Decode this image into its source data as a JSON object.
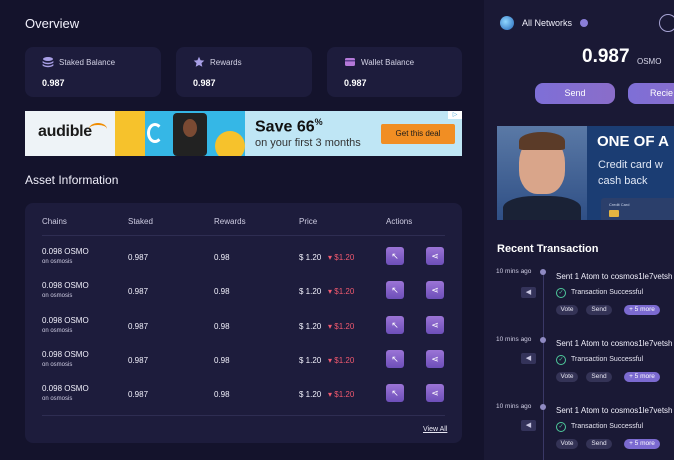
{
  "overview": {
    "title": "Overview",
    "cards": [
      {
        "label": "Staked Balance",
        "value": "0.987",
        "icon": "stack-icon"
      },
      {
        "label": "Rewards",
        "value": "0.987",
        "icon": "star-icon"
      },
      {
        "label": "Wallet Balance",
        "value": "0.987",
        "icon": "wallet-icon"
      }
    ]
  },
  "ad_banner": {
    "brand": "audible",
    "headline": "Save 66",
    "headline_sup": "%",
    "subline": "on your first 3 months",
    "cta": "Get this deal"
  },
  "assets": {
    "title": "Asset Information",
    "headers": [
      "Chains",
      "Staked",
      "Rewards",
      "Price",
      "Actions"
    ],
    "rows": [
      {
        "chain": "0.098 OSMO",
        "sub": "on osmosis",
        "staked": "0.987",
        "rewards": "0.98",
        "price": "$ 1.20",
        "change": "$1.20"
      },
      {
        "chain": "0.098 OSMO",
        "sub": "on osmosis",
        "staked": "0.987",
        "rewards": "0.98",
        "price": "$ 1.20",
        "change": "$1.20"
      },
      {
        "chain": "0.098 OSMO",
        "sub": "on osmosis",
        "staked": "0.987",
        "rewards": "0.98",
        "price": "$ 1.20",
        "change": "$1.20"
      },
      {
        "chain": "0.098 OSMO",
        "sub": "on osmosis",
        "staked": "0.987",
        "rewards": "0.98",
        "price": "$ 1.20",
        "change": "$1.20"
      },
      {
        "chain": "0.098 OSMO",
        "sub": "on osmosis",
        "staked": "0.987",
        "rewards": "0.98",
        "price": "$ 1.20",
        "change": "$1.20"
      }
    ],
    "view_all": "View All"
  },
  "sidebar": {
    "network": "All Networks",
    "balance": "0.987",
    "unit": "OSMO",
    "send": "Send",
    "receive": "Recie",
    "ad": {
      "headline": "ONE OF A",
      "line1": "Credit card w",
      "line2": "cash back",
      "card_label": "Credit Card"
    },
    "recent_title": "Recent Transaction",
    "transactions": [
      {
        "time": "10 mins ago",
        "text": "Sent 1 Atom to cosmos1le7vetsh",
        "status": "Transaction Successful",
        "tags": [
          "Vote",
          "Send",
          "+ 5 more"
        ]
      },
      {
        "time": "10 mins ago",
        "text": "Sent 1 Atom to cosmos1le7vetsh",
        "status": "Transaction Successful",
        "tags": [
          "Vote",
          "Send",
          "+ 5 more"
        ]
      },
      {
        "time": "10 mins ago",
        "text": "Sent 1 Atom to cosmos1le7vetsh",
        "status": "Transaction Successful",
        "tags": [
          "Vote",
          "Send",
          "+ 5 more"
        ]
      }
    ]
  },
  "colors": {
    "background": "#14132c",
    "card": "#1d1c3c",
    "accent": "#7e6fd7",
    "negative": "#f0596f",
    "success": "#4ec99b"
  }
}
